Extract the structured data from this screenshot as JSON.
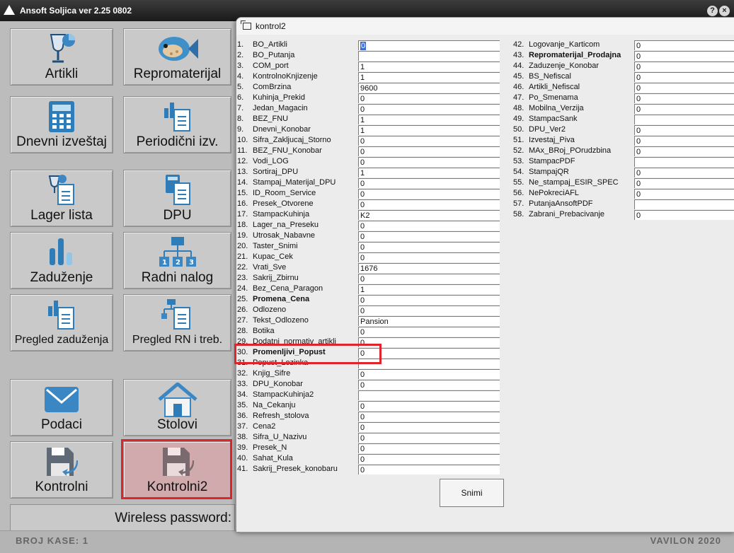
{
  "window": {
    "title": "Ansoft Soljica ver 2.25 0802",
    "help_label": "?",
    "close_label": "×"
  },
  "tiles": [
    {
      "label": "Artikli",
      "icon": "wineglass-chart-icon"
    },
    {
      "label": "Repromaterijal",
      "icon": "fish-icon"
    },
    {
      "label": "Dnevni izveštaj",
      "icon": "calculator-icon"
    },
    {
      "label": "Periodični izv.",
      "icon": "chart-document-icon"
    },
    {
      "label": "Lager lista",
      "icon": "wineglass-document-icon"
    },
    {
      "label": "DPU",
      "icon": "calculator-document-icon"
    },
    {
      "label": "Zaduženje",
      "icon": "bar-chart-icon"
    },
    {
      "label": "Radni nalog",
      "icon": "org-chart-icon"
    },
    {
      "label": "Pregled zaduženja",
      "icon": "chart-document-icon"
    },
    {
      "label": "Pregled RN i treb.",
      "icon": "org-document-icon"
    },
    {
      "label": "Podaci",
      "icon": "envelope-icon"
    },
    {
      "label": "Stolovi",
      "icon": "house-icon"
    },
    {
      "label": "Kontrolni",
      "icon": "floppy-arrow-icon"
    },
    {
      "label": "Kontrolni2",
      "icon": "floppy-arrow-icon"
    }
  ],
  "wireless_label": "Wireless password:",
  "status": {
    "left": "BROJ KASE: 1",
    "right": "VAVILON 2020"
  },
  "dialog": {
    "title": "kontrol2",
    "save_label": "Snimi",
    "left_rows": [
      {
        "num": "1.",
        "label": "BO_Artikli",
        "value": "0"
      },
      {
        "num": "2.",
        "label": "BO_Putanja",
        "value": ""
      },
      {
        "num": "3.",
        "label": "COM_port",
        "value": "1"
      },
      {
        "num": "4.",
        "label": "KontrolnoKnjizenje",
        "value": "1"
      },
      {
        "num": "5.",
        "label": "ComBrzina",
        "value": "9600"
      },
      {
        "num": "6.",
        "label": "Kuhinja_Prekid",
        "value": "0"
      },
      {
        "num": "7.",
        "label": "Jedan_Magacin",
        "value": "0"
      },
      {
        "num": "8.",
        "label": "BEZ_FNU",
        "value": "1"
      },
      {
        "num": "9.",
        "label": "Dnevni_Konobar",
        "value": "1"
      },
      {
        "num": "10.",
        "label": "Sifra_Zakljucaj_Storno",
        "value": "0"
      },
      {
        "num": "11.",
        "label": "BEZ_FNU_Konobar",
        "value": "0"
      },
      {
        "num": "12.",
        "label": "Vodi_LOG",
        "value": "0"
      },
      {
        "num": "13.",
        "label": "Sortiraj_DPU",
        "value": "1"
      },
      {
        "num": "14.",
        "label": "Stampaj_Materijal_DPU",
        "value": "0"
      },
      {
        "num": "15.",
        "label": "ID_Room_Service",
        "value": "0"
      },
      {
        "num": "16.",
        "label": "Presek_Otvorene",
        "value": "0"
      },
      {
        "num": "17.",
        "label": "StampacKuhinja",
        "value": "K2"
      },
      {
        "num": "18.",
        "label": "Lager_na_Preseku",
        "value": "0"
      },
      {
        "num": "19.",
        "label": "Utrosak_Nabavne",
        "value": "0"
      },
      {
        "num": "20.",
        "label": "Taster_Snimi",
        "value": "0"
      },
      {
        "num": "21.",
        "label": "Kupac_Cek",
        "value": "0"
      },
      {
        "num": "22.",
        "label": "Vrati_Sve",
        "value": "1676"
      },
      {
        "num": "23.",
        "label": "Sakrij_Zbirnu",
        "value": "0"
      },
      {
        "num": "24.",
        "label": "Bez_Cena_Paragon",
        "value": "1"
      },
      {
        "num": "25.",
        "label": "Promena_Cena",
        "value": "0",
        "bold": true
      },
      {
        "num": "26.",
        "label": "Odlozeno",
        "value": "0"
      },
      {
        "num": "27.",
        "label": "Tekst_Odlozeno",
        "value": "Pansion"
      },
      {
        "num": "28.",
        "label": "Botika",
        "value": "0"
      },
      {
        "num": "29.",
        "label": "Dodatni_normativ_artikli",
        "value": "0"
      },
      {
        "num": "30.",
        "label": "Promenljivi_Popust",
        "value": "0",
        "bold": true
      },
      {
        "num": "31.",
        "label": "Popust_Lozinka",
        "value": ""
      },
      {
        "num": "32.",
        "label": "Knjig_Sifre",
        "value": "0"
      },
      {
        "num": "33.",
        "label": "DPU_Konobar",
        "value": "0"
      },
      {
        "num": "34.",
        "label": "StampacKuhinja2",
        "value": ""
      },
      {
        "num": "35.",
        "label": "Na_Cekanju",
        "value": "0"
      },
      {
        "num": "36.",
        "label": "Refresh_stolova",
        "value": "0"
      },
      {
        "num": "37.",
        "label": "Cena2",
        "value": "0"
      },
      {
        "num": "38.",
        "label": "Sifra_U_Nazivu",
        "value": "0"
      },
      {
        "num": "39.",
        "label": "Presek_N",
        "value": "0"
      },
      {
        "num": "40.",
        "label": "Sahat_Kula",
        "value": "0"
      },
      {
        "num": "41.",
        "label": "Sakrij_Presek_konobaru",
        "value": "0"
      }
    ],
    "right_rows": [
      {
        "num": "42.",
        "label": "Logovanje_Karticom",
        "value": "0"
      },
      {
        "num": "43.",
        "label": "Repromaterijal_Prodajna",
        "value": "0",
        "bold": true
      },
      {
        "num": "44.",
        "label": "Zaduzenje_Konobar",
        "value": "0"
      },
      {
        "num": "45.",
        "label": "BS_Nefiscal",
        "value": "0"
      },
      {
        "num": "46.",
        "label": "Artikli_Nefiscal",
        "value": "0"
      },
      {
        "num": "47.",
        "label": "Po_Smenama",
        "value": "0"
      },
      {
        "num": "48.",
        "label": "Mobilna_Verzija",
        "value": "0"
      },
      {
        "num": "49.",
        "label": "StampacSank",
        "value": ""
      },
      {
        "num": "50.",
        "label": "DPU_Ver2",
        "value": "0"
      },
      {
        "num": "51.",
        "label": "Izvestaj_Piva",
        "value": "0"
      },
      {
        "num": "52.",
        "label": "MAx_BRoj_POrudzbina",
        "value": "0"
      },
      {
        "num": "53.",
        "label": "StampacPDF",
        "value": ""
      },
      {
        "num": "54.",
        "label": "StampajQR",
        "value": "0"
      },
      {
        "num": "55.",
        "label": "Ne_stampaj_ESIR_SPEC",
        "value": "0"
      },
      {
        "num": "56.",
        "label": "NePokreciAFL",
        "value": "0"
      },
      {
        "num": "57.",
        "label": "PutanjaAnsoftPDF",
        "value": ""
      },
      {
        "num": "58.",
        "label": "Zabrani_Prebacivanje",
        "value": "0"
      }
    ]
  }
}
